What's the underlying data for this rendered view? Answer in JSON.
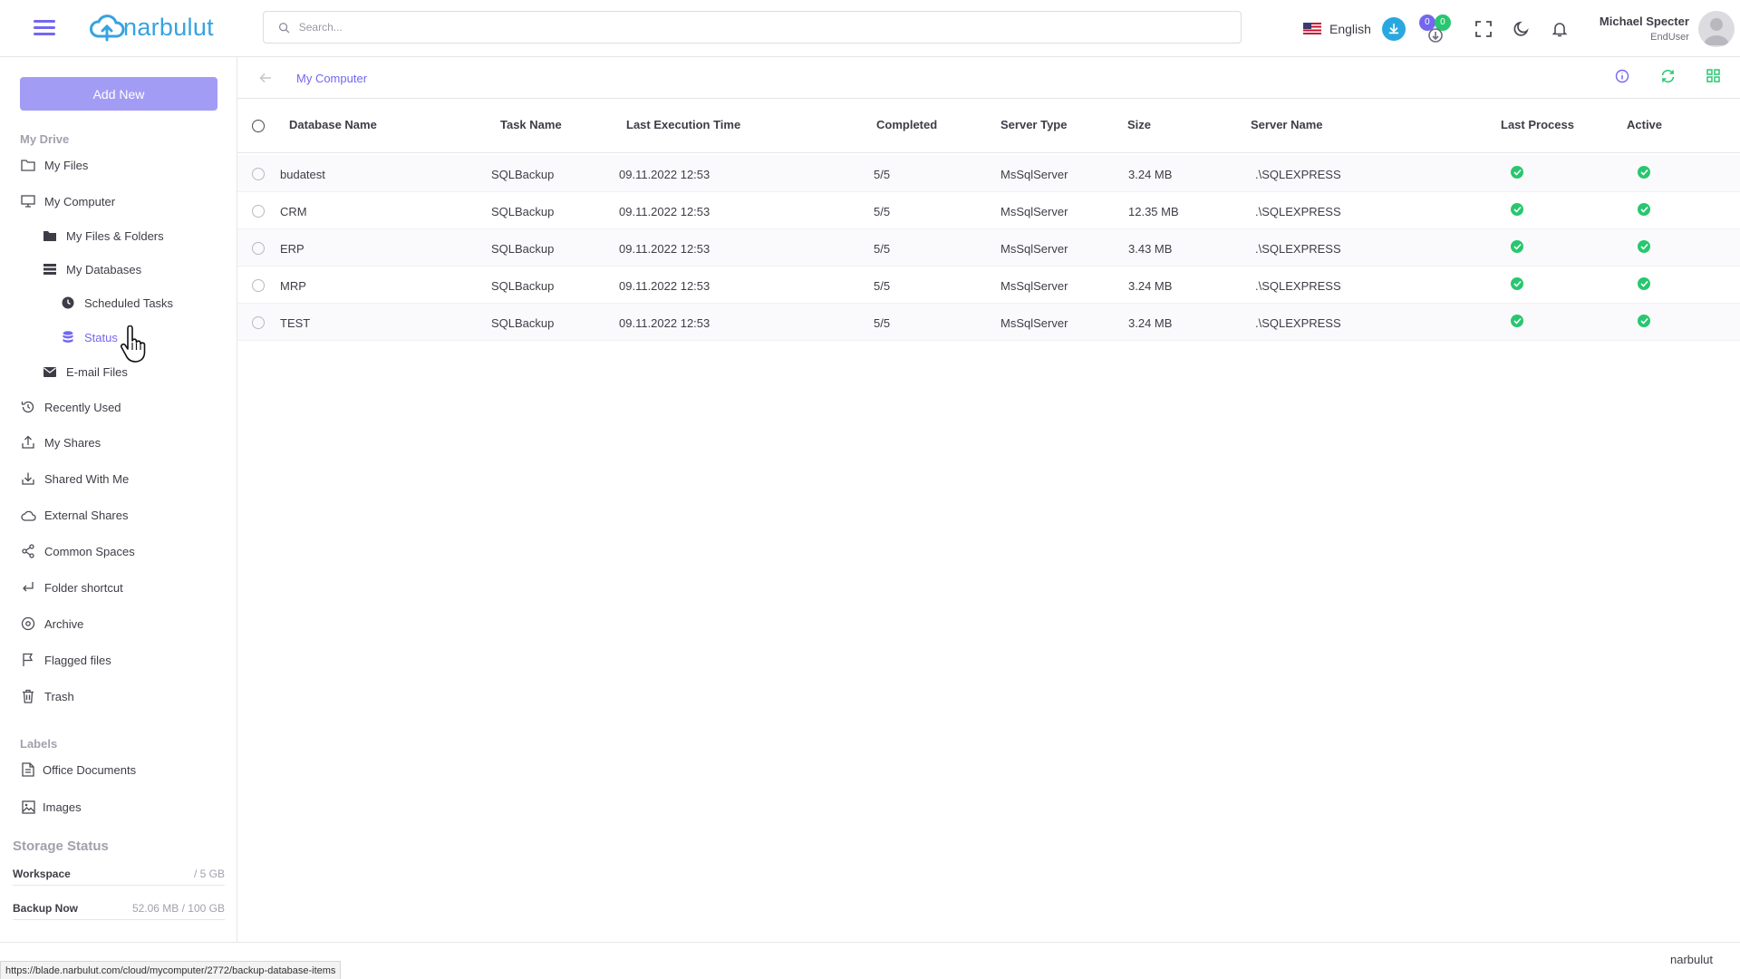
{
  "header": {
    "brand": "narbulut",
    "search_placeholder": "Search...",
    "language": "English",
    "badge_left": "0",
    "badge_right": "0",
    "user_name": "Michael Specter",
    "user_role": "EndUser"
  },
  "sidebar": {
    "add_new": "Add New",
    "my_drive_label": "My Drive",
    "items": {
      "my_files": "My Files",
      "my_computer": "My Computer",
      "my_files_folders": "My Files & Folders",
      "my_databases": "My Databases",
      "scheduled_tasks": "Scheduled Tasks",
      "status": "Status",
      "email_files": "E-mail Files",
      "recently_used": "Recently Used",
      "my_shares": "My Shares",
      "shared_with_me": "Shared With Me",
      "external_shares": "External Shares",
      "common_spaces": "Common Spaces",
      "folder_shortcut": "Folder shortcut",
      "archive": "Archive",
      "flagged_files": "Flagged files",
      "trash": "Trash"
    },
    "labels_label": "Labels",
    "labels": {
      "office_documents": "Office Documents",
      "images": "Images"
    },
    "storage": {
      "title": "Storage Status",
      "workspace_name": "Workspace",
      "workspace_value": "/ 5 GB",
      "backup_name": "Backup Now",
      "backup_value": "52.06 MB / 100 GB"
    }
  },
  "main": {
    "breadcrumb": "My Computer",
    "columns": {
      "database_name": "Database Name",
      "task_name": "Task Name",
      "last_execution_time": "Last Execution Time",
      "completed": "Completed",
      "server_type": "Server Type",
      "size": "Size",
      "server_name": "Server Name",
      "last_process": "Last Process",
      "active": "Active"
    },
    "rows": [
      {
        "db": "budatest",
        "task": "SQLBackup",
        "time": "09.11.2022 12:53",
        "completed": "5/5",
        "server_type": "MsSqlServer",
        "size": "3.24 MB",
        "server_name": ".\\SQLEXPRESS",
        "last_process": true,
        "active": true
      },
      {
        "db": "CRM",
        "task": "SQLBackup",
        "time": "09.11.2022 12:53",
        "completed": "5/5",
        "server_type": "MsSqlServer",
        "size": "12.35 MB",
        "server_name": ".\\SQLEXPRESS",
        "last_process": true,
        "active": true
      },
      {
        "db": "ERP",
        "task": "SQLBackup",
        "time": "09.11.2022 12:53",
        "completed": "5/5",
        "server_type": "MsSqlServer",
        "size": "3.43 MB",
        "server_name": ".\\SQLEXPRESS",
        "last_process": true,
        "active": true
      },
      {
        "db": "MRP",
        "task": "SQLBackup",
        "time": "09.11.2022 12:53",
        "completed": "5/5",
        "server_type": "MsSqlServer",
        "size": "3.24 MB",
        "server_name": ".\\SQLEXPRESS",
        "last_process": true,
        "active": true
      },
      {
        "db": "TEST",
        "task": "SQLBackup",
        "time": "09.11.2022 12:53",
        "completed": "5/5",
        "server_type": "MsSqlServer",
        "size": "3.24 MB",
        "server_name": ".\\SQLEXPRESS",
        "last_process": true,
        "active": true
      }
    ]
  },
  "statusbar": {
    "url": "https://blade.narbulut.com/cloud/mycomputer/2772/backup-database-items",
    "brand": "narbulut"
  },
  "colors": {
    "accent": "#7367f0",
    "accent_light": "#a39cf4",
    "success": "#28c76f",
    "brand_blue": "#36a3e0"
  }
}
